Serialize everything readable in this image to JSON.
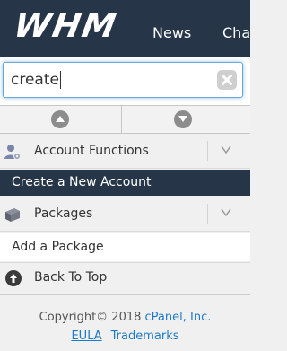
{
  "header": {
    "logo": "WHM",
    "nav": [
      "News",
      "Cha"
    ]
  },
  "search": {
    "value": "create",
    "placeholder": ""
  },
  "sidebar": {
    "groups": [
      {
        "label": "Account Functions",
        "items": [
          {
            "label": "Create a New Account",
            "active": true
          }
        ]
      },
      {
        "label": "Packages",
        "items": [
          {
            "label": "Add a Package",
            "active": false
          }
        ]
      }
    ],
    "back_to_top": "Back To Top"
  },
  "footer": {
    "copyright_prefix": "Copyright© 2018 ",
    "company": "cPanel, Inc.",
    "eula": "EULA",
    "trademarks": "Trademarks"
  },
  "colors": {
    "header_bg": "#263648",
    "active_bg": "#263648",
    "link": "#1c7ac9",
    "focus_ring": "#6aa6d6"
  },
  "icons": [
    "clear-icon",
    "arrow-up-icon",
    "arrow-down-icon",
    "user-gear-icon",
    "chevron-down-icon",
    "package-icon",
    "up-circle-icon"
  ]
}
